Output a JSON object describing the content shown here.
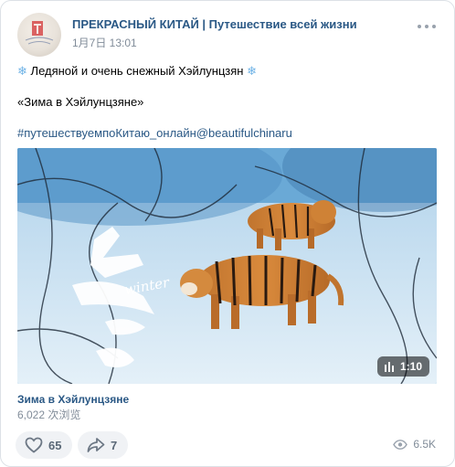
{
  "post": {
    "author": "ПРЕКРАСНЫЙ КИТАЙ | Путешествие всей жизни",
    "date": "1月7日 13:01",
    "line1": "Ледяной и очень снежный Хэйлунцзян",
    "line2": "«Зима в Хэйлунцзяне»",
    "hashtag": "#путешествуемпоКитаю_онлайн@beautifulchinaru"
  },
  "video": {
    "duration": "1:10",
    "overlay_char": "冬",
    "overlay_word": "winter",
    "title": "Зима в Хэйлунцзяне",
    "views": "6,022 次浏览"
  },
  "footer": {
    "likes": "65",
    "shares": "7",
    "views": "6.5K"
  },
  "icons": {
    "more": "more-dots-icon",
    "snowflake": "snowflake-icon",
    "like": "heart-icon",
    "share": "share-arrow-icon",
    "views": "eye-icon",
    "duration": "clip-icon"
  },
  "colors": {
    "link": "#2a5885",
    "muted": "#818c99",
    "snow": "#6fb3e6"
  }
}
